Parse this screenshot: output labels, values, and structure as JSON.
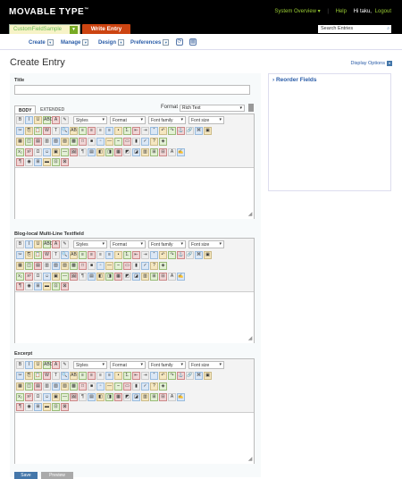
{
  "header": {
    "logo": "MOVABLE TYPE",
    "logo_tm": "™",
    "system_overview": "System Overview ▾",
    "help": "Help",
    "greeting": "Hi taku,",
    "logout": "Logout"
  },
  "blogbar": {
    "blog_name": "CustomFieldSample",
    "write_entry": "Write Entry",
    "search_placeholder": "Search Entries"
  },
  "nav": {
    "items": [
      {
        "label": "Create"
      },
      {
        "label": "Manage"
      },
      {
        "label": "Design"
      },
      {
        "label": "Preferences"
      }
    ]
  },
  "page": {
    "title": "Create Entry",
    "display_options": "Display Options"
  },
  "sidebar": {
    "heading": "Reorder Fields"
  },
  "form": {
    "title_label": "Title",
    "tabs": [
      "BODY",
      "EXTENDED"
    ],
    "format_label": "Format",
    "format_value": "Rich Text",
    "fields": [
      {
        "label": ""
      },
      {
        "label": "Blog-local Multi-Line Textfield"
      },
      {
        "label": "Excerpt"
      }
    ],
    "save": "Save",
    "preview": "Preview"
  },
  "toolbar": {
    "styles": "Styles",
    "format": "Format",
    "font_family": "Font family",
    "font_size": "Font size"
  },
  "colors": {
    "accent_green": "#99cc33",
    "write_entry_bg": "#cc4411",
    "link_blue": "#2a5ca8"
  }
}
